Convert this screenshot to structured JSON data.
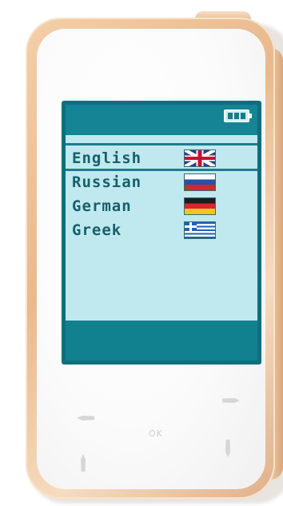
{
  "device": {
    "ok_label": "OK"
  },
  "screen": {
    "battery_level": 1.0,
    "languages": [
      {
        "label": "English",
        "flag": "uk-flag",
        "selected": true
      },
      {
        "label": "Russian",
        "flag": "russia-flag",
        "selected": false
      },
      {
        "label": "German",
        "flag": "germany-flag",
        "selected": false
      },
      {
        "label": "Greek",
        "flag": "greece-flag",
        "selected": false
      }
    ]
  },
  "colors": {
    "lcd_accent": "#1b8c9c",
    "lcd_background": "#bfe9ee",
    "text": "#165f6b",
    "device_trim": "#e9b98d"
  }
}
